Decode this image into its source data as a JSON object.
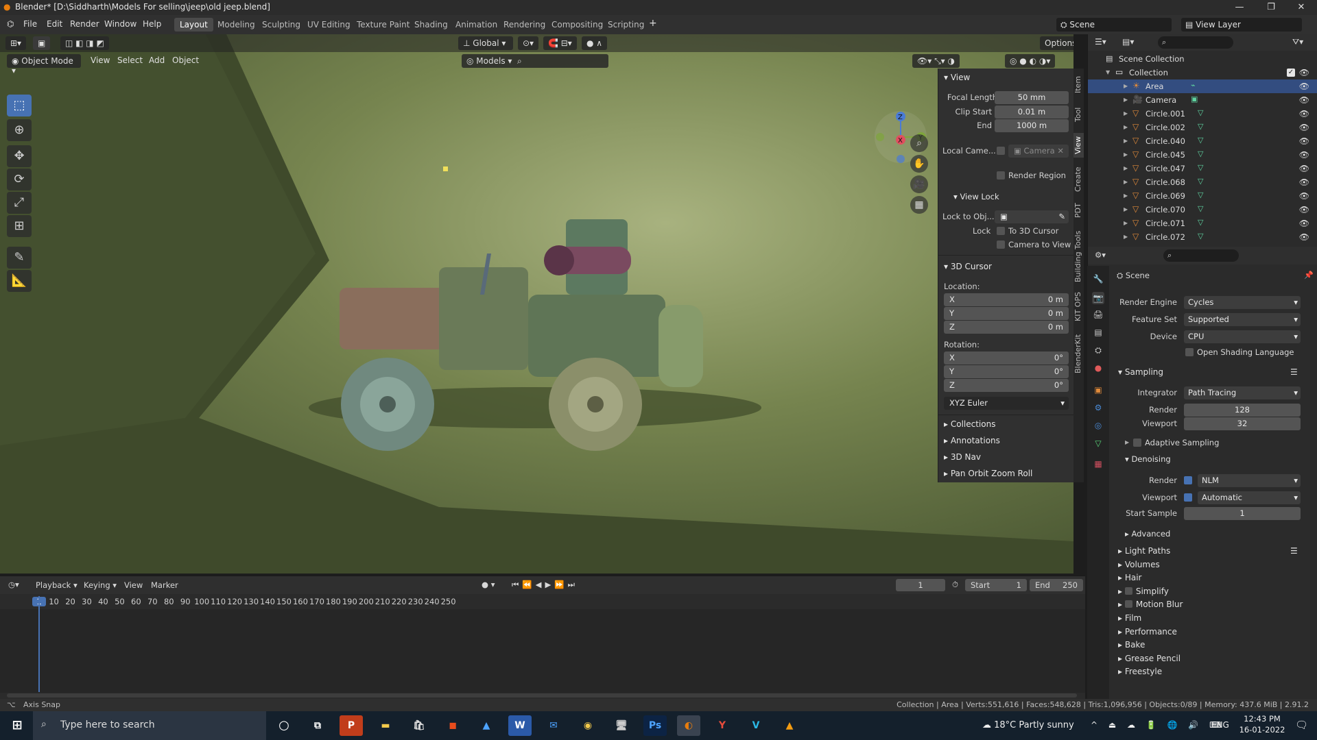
{
  "window": {
    "title": "Blender* [D:\\Siddharth\\Models For selling\\jeep\\old jeep.blend]"
  },
  "menu": [
    "File",
    "Edit",
    "Render",
    "Window",
    "Help"
  ],
  "workspaces": [
    "Layout",
    "Modeling",
    "Sculpting",
    "UV Editing",
    "Texture Paint",
    "Shading",
    "Animation",
    "Rendering",
    "Compositing",
    "Scripting"
  ],
  "active_workspace": "Layout",
  "scene": "Scene",
  "view_layer": "View Layer",
  "viewport": {
    "mode": "Object Mode",
    "menus": [
      "View",
      "Select",
      "Add",
      "Object"
    ],
    "orientation": "Global",
    "collection_filter": "Models",
    "options": "Options"
  },
  "npanel": {
    "view_header": "View",
    "focal_length_label": "Focal Length",
    "focal_length": "50 mm",
    "clip_start_label": "Clip Start",
    "clip_start": "0.01 m",
    "end_label": "End",
    "end": "1000 m",
    "local_camera_label": "Local Came...",
    "local_camera": "Camera",
    "render_region": "Render Region",
    "view_lock_header": "View Lock",
    "lock_to_obj_label": "Lock to Obj...",
    "lock_label": "Lock",
    "to_3d_cursor": "To 3D Cursor",
    "camera_to_view": "Camera to View",
    "cursor_header": "3D Cursor",
    "location_label": "Location:",
    "loc_x": "0 m",
    "loc_y": "0 m",
    "loc_z": "0 m",
    "rotation_label": "Rotation:",
    "rot_x": "0°",
    "rot_y": "0°",
    "rot_z": "0°",
    "rotation_mode": "XYZ Euler",
    "x": "X",
    "y": "Y",
    "z": "Z",
    "collapsed": [
      "Collections",
      "Annotations",
      "3D Nav",
      "Pan Orbit Zoom Roll"
    ],
    "tabs": [
      "Item",
      "Tool",
      "View",
      "Create",
      "PDT",
      "Building Tools",
      "KIT OPS",
      "BlenderKit"
    ]
  },
  "outliner": {
    "scene_collection": "Scene Collection",
    "collection": "Collection",
    "items": [
      "Area",
      "Camera",
      "Circle.001",
      "Circle.002",
      "Circle.040",
      "Circle.045",
      "Circle.047",
      "Circle.068",
      "Circle.069",
      "Circle.070",
      "Circle.071",
      "Circle.072"
    ]
  },
  "properties": {
    "context": "Scene",
    "render_engine_label": "Render Engine",
    "render_engine": "Cycles",
    "feature_set_label": "Feature Set",
    "feature_set": "Supported",
    "device_label": "Device",
    "device": "CPU",
    "osl": "Open Shading Language",
    "sampling": "Sampling",
    "integrator_label": "Integrator",
    "integrator": "Path Tracing",
    "render_label": "Render",
    "render_samples": "128",
    "viewport_label": "Viewport",
    "viewport_samples": "32",
    "adaptive": "Adaptive Sampling",
    "denoising": "Denoising",
    "den_render": "NLM",
    "den_viewport": "Automatic",
    "start_sample_label": "Start Sample",
    "start_sample": "1",
    "advanced": "Advanced",
    "sections": [
      "Light Paths",
      "Volumes",
      "Hair",
      "Simplify",
      "Motion Blur",
      "Film",
      "Performance",
      "Bake",
      "Grease Pencil",
      "Freestyle"
    ]
  },
  "timeline": {
    "menus": [
      "Playback",
      "Keying",
      "View",
      "Marker"
    ],
    "current_frame": "1",
    "start_label": "Start",
    "start": "1",
    "end_label": "End",
    "end": "250",
    "ticks": [
      "1",
      "10",
      "20",
      "30",
      "40",
      "50",
      "60",
      "70",
      "80",
      "90",
      "100",
      "110",
      "120",
      "130",
      "140",
      "150",
      "160",
      "170",
      "180",
      "190",
      "200",
      "210",
      "220",
      "230",
      "240",
      "250"
    ]
  },
  "status": {
    "left": "Axis Snap",
    "right": "Collection | Area | Verts:551,616 | Faces:548,628 | Tris:1,096,956 | Objects:0/89 | Memory: 437.6 MiB | 2.91.2"
  },
  "taskbar": {
    "search_placeholder": "Type here to search",
    "weather": "18°C  Partly sunny",
    "lang": "ENG",
    "time": "12:43 PM",
    "date": "16-01-2022"
  },
  "colors": {
    "accent": "#4772b3",
    "viewport_bg": "#5c6b45",
    "selection": "#334d80"
  }
}
